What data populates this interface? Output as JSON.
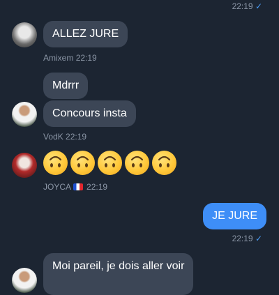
{
  "messages": {
    "m0_time": "22:19",
    "m0_check": "✓",
    "m1_text": "ALLEZ JURE",
    "m1_sender": "Amixem",
    "m1_time": "22:19",
    "m2a_text": "Mdrrr",
    "m2b_text": "Concours insta",
    "m2_sender": "VodK",
    "m2_time": "22:19",
    "m3_emojis": [
      "upside-down-face",
      "upside-down-face",
      "upside-down-face",
      "upside-down-face",
      "upside-down-face"
    ],
    "m3_sender": "JOYCA",
    "m3_flag": "french-flag",
    "m3_time": "22:19",
    "m4_text": "JE JURE",
    "m4_time": "22:19",
    "m4_check": "✓",
    "m5_text": "Moi pareil, je dois aller voir"
  },
  "colors": {
    "background": "#1c2532",
    "incoming_bubble": "#3c4656",
    "outgoing_bubble": "#3e8ef7",
    "meta_text": "#8b96a6",
    "checkmark": "#4a9cf5"
  }
}
